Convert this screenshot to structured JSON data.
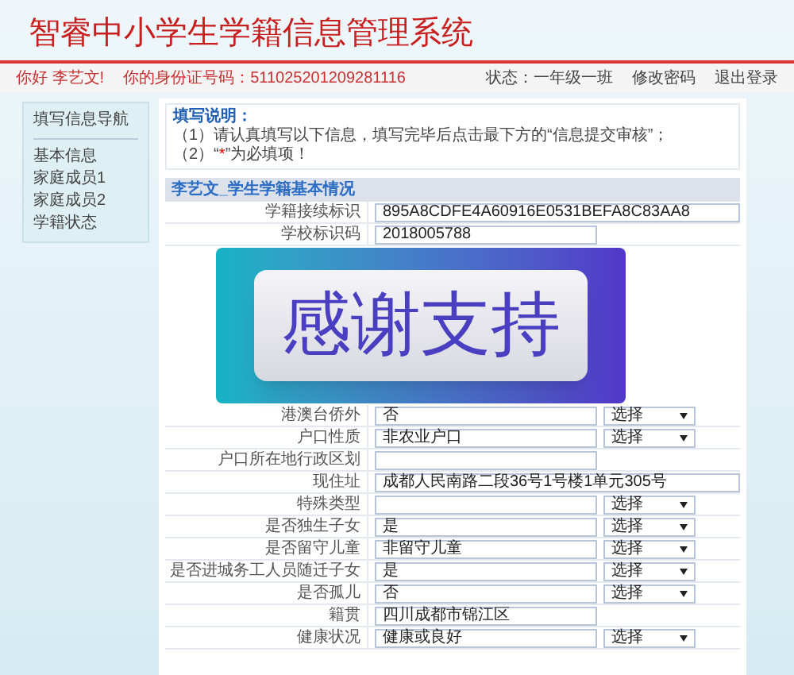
{
  "header": {
    "title": "智睿中小学生学籍信息管理系统"
  },
  "user_bar": {
    "greeting": "你好 李艺文!",
    "id_label": "你的身份证号码：511025201209281116",
    "status": "状态：一年级一班",
    "links": [
      "修改密码",
      "退出登录"
    ]
  },
  "sidebar": {
    "title": "填写信息导航",
    "items": [
      "基本信息",
      "家庭成员1",
      "家庭成员2",
      "学籍状态"
    ]
  },
  "instructions": {
    "title": "填写说明：",
    "lines": [
      {
        "before": "（1）请认真填写以下信息，填写完毕后点击最下方的“信息提交审核”；"
      },
      {
        "before": "（2）“",
        "mark": "*",
        "after": "”为必填项！"
      }
    ]
  },
  "section": {
    "title": "李艺文_学生学籍基本情况"
  },
  "rows_top": [
    {
      "kind": "long",
      "label": "学籍接续标识",
      "value": "895A8CDFE4A60916E0531BEFA8C83AA8"
    },
    {
      "kind": "text",
      "label": "学校标识码",
      "value": "2018005788"
    }
  ],
  "banner": {
    "text": "感谢支持"
  },
  "rows": [
    {
      "kind": "text_select",
      "label": "港澳台侨外",
      "value": "否",
      "select": "选择"
    },
    {
      "kind": "text_select",
      "label": "户口性质",
      "value": "非农业户口",
      "select": "选择"
    },
    {
      "kind": "text",
      "label": "户口所在地行政区划"
    },
    {
      "kind": "long",
      "label": "现住址",
      "value": "成都人民南路二段36号1号楼1单元305号"
    },
    {
      "kind": "text_select",
      "label": "特殊类型",
      "select": "选择"
    },
    {
      "kind": "text_select",
      "label": "是否独生子女",
      "value": "是",
      "select": "选择"
    },
    {
      "kind": "text_select",
      "label": "是否留守儿童",
      "value": "非留守儿童",
      "select": "选择"
    },
    {
      "kind": "text_select",
      "label": "是否进城务工人员随迁子女",
      "value": "是",
      "select": "选择"
    },
    {
      "kind": "text_select",
      "label": "是否孤儿",
      "value": "否",
      "select": "选择"
    },
    {
      "kind": "text",
      "label": "籍贯",
      "value": "四川成都市锦江区"
    },
    {
      "kind": "text_select",
      "label": "健康状况",
      "value": "健康或良好",
      "select": "选择"
    }
  ]
}
